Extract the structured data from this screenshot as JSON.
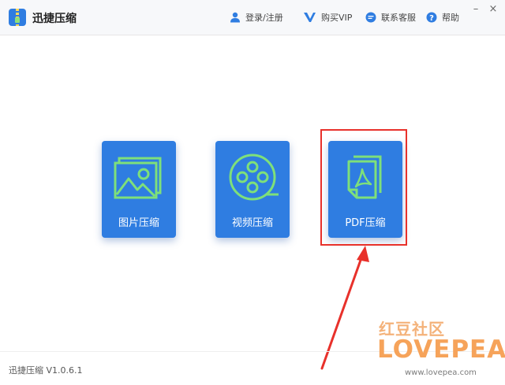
{
  "app": {
    "title": "迅捷压缩",
    "version": "迅捷压缩 V1.0.6.1"
  },
  "header": {
    "login": {
      "label": "登录/注册",
      "icon": "user-icon"
    },
    "vip": {
      "label": "购买VIP",
      "icon": "vip-icon"
    },
    "support": {
      "label": "联系客服",
      "icon": "chat-icon"
    },
    "help": {
      "label": "帮助",
      "icon": "help-icon"
    },
    "window_controls": [
      "minimize",
      "close"
    ]
  },
  "cards": [
    {
      "label": "图片压缩",
      "icon": "image-icon"
    },
    {
      "label": "视频压缩",
      "icon": "film-reel-icon"
    },
    {
      "label": "PDF压缩",
      "icon": "pdf-icon",
      "highlighted": true
    }
  ],
  "watermark": {
    "chinese": "红豆社区",
    "logo": "LOVEPEA",
    "url": "www.lovepea.com"
  },
  "colors": {
    "card_blue": "#2f7de1",
    "icon_green": "#7ee07a",
    "highlight_red": "#e8312b",
    "watermark_orange": "#f6a35a"
  }
}
